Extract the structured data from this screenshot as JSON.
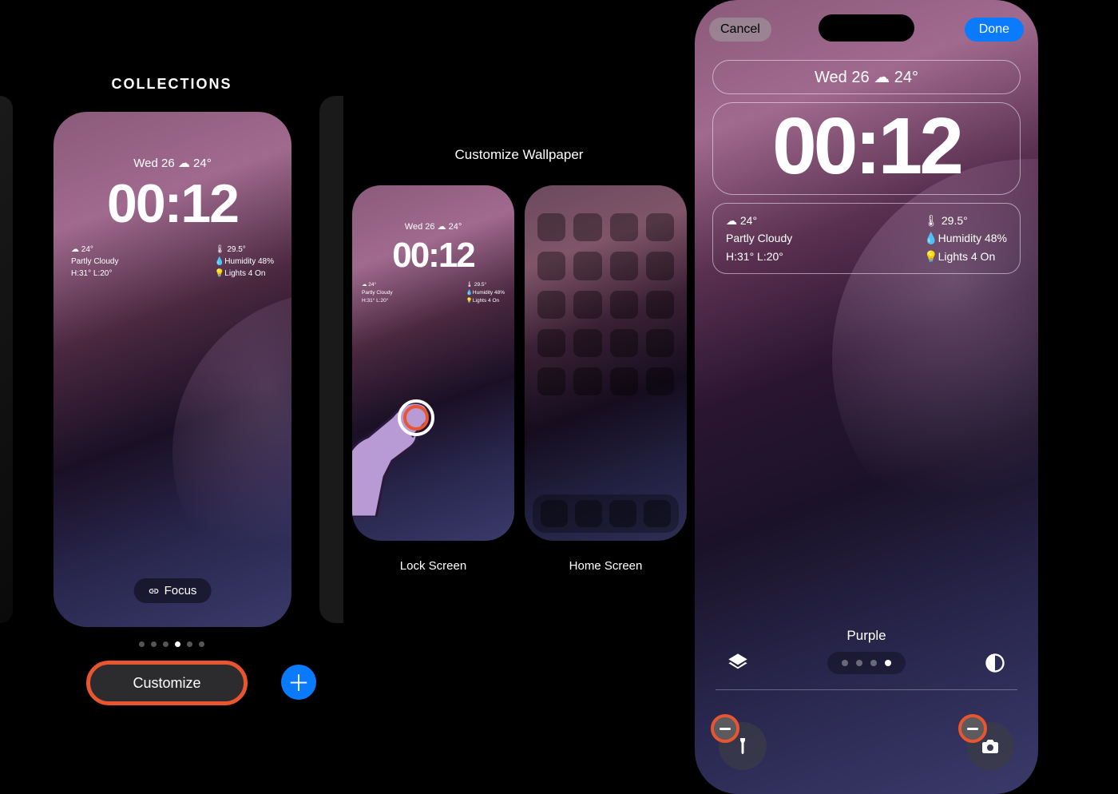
{
  "panel1": {
    "title": "COLLECTIONS",
    "date_line": "Wed 26 ☁ 24°",
    "time": "00:12",
    "weather_widget": {
      "temp": "☁ 24°",
      "cond": "Partly Cloudy",
      "hilo": "H:31° L:20°"
    },
    "home_widget": {
      "temp": "🌡 29.5°",
      "humidity": "💧Humidity  48%",
      "lights": "💡Lights     4 On"
    },
    "focus_label": "Focus",
    "customize_label": "Customize",
    "add_label": "＋"
  },
  "panel2": {
    "title": "Customize Wallpaper",
    "lock_label": "Lock Screen",
    "home_label": "Home Screen",
    "date_line": "Wed 26 ☁ 24°",
    "time": "00:12",
    "weather_widget": {
      "temp": "☁ 24°",
      "cond": "Partly Cloudy",
      "hilo": "H:31° L:20°"
    },
    "home_widget": {
      "temp": "🌡 29.5°",
      "humidity": "💧Humidity 48%",
      "lights": "💡Lights   4 On"
    }
  },
  "panel3": {
    "cancel": "Cancel",
    "done": "Done",
    "date_line": "Wed 26 ☁ 24°",
    "time": "00:12",
    "weather_widget": {
      "temp": "☁ 24°",
      "cond": "Partly Cloudy",
      "hilo": "H:31° L:20°"
    },
    "home_widget": {
      "temp": "🌡 29.5°",
      "humidity": "💧Humidity  48%",
      "lights": "💡Lights     4 On"
    },
    "color_name": "Purple"
  }
}
